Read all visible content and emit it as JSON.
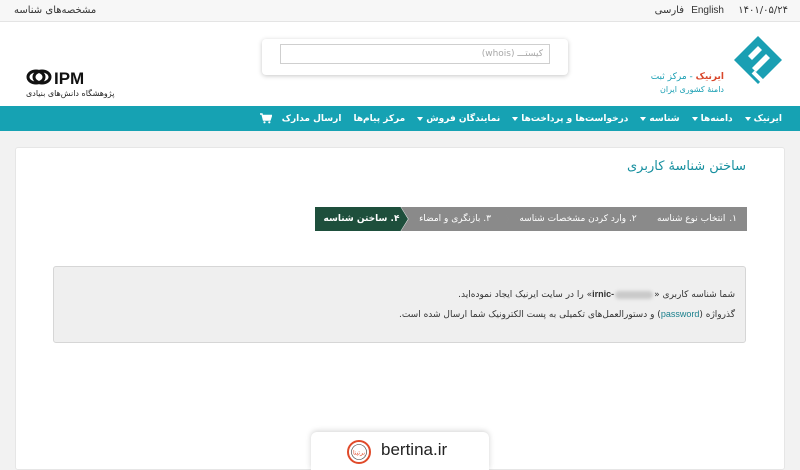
{
  "topbar": {
    "identities_link": "مشخصه‌های شناسه",
    "date": "۱۴۰۱/۰۵/۲۴",
    "lang_en": "English",
    "lang_fa": "فارسی"
  },
  "header": {
    "search_placeholder": "کیستـــ (whois)",
    "ipm_mark": "IPM",
    "ipm_subtitle": "پژوهشگاه دانش‌های بنیادی",
    "brand_name": "ایرنیک",
    "brand_suffix": " - مرکز ثبت",
    "brand_line2": "دامنهٔ کشوری ایران"
  },
  "nav": {
    "items": [
      {
        "label": "ایرنیک",
        "caret": true
      },
      {
        "label": "دامنه‌ها",
        "caret": true
      },
      {
        "label": "شناسه",
        "caret": true
      },
      {
        "label": "درخواست‌ها و پرداخت‌ها",
        "caret": true
      },
      {
        "label": "نمایندگان فروش",
        "caret": true
      },
      {
        "label": "مرکز پیام‌ها",
        "caret": false
      },
      {
        "label": "ارسال مدارک",
        "caret": false
      }
    ],
    "cart_icon": "shopping-cart-icon"
  },
  "main": {
    "title": "ساختن شناسهٔ کاربری",
    "steps": [
      {
        "num": "۱.",
        "label": "انتخاب نوع شناسه"
      },
      {
        "num": "۲.",
        "label": "وارد کردن مشخصات شناسه"
      },
      {
        "num": "۳.",
        "label": "بازنگری و امضاء"
      },
      {
        "num": "۴.",
        "label": "ساختن شناسه"
      }
    ],
    "message": {
      "line1_prefix": "شما شناسه کاربری «",
      "line1_user": "-irnic",
      "line1_suffix": "» را در سایت ایرنیک ایجاد نموده‌اید.",
      "line2_prefix": "گذرواژه (",
      "line2_pw": "password",
      "line2_suffix": ") و دستورالعمل‌های تکمیلی به پست الکترونیک شما ارسال شده است."
    }
  },
  "watermark": {
    "text": "bertina.ir",
    "icon_text": "برتینا"
  },
  "colors": {
    "nav_bg": "#16a2b3",
    "brand_teal": "#1a9fb3",
    "active_step": "#1e4f3c",
    "inactive_step": "#8a8a8a"
  }
}
